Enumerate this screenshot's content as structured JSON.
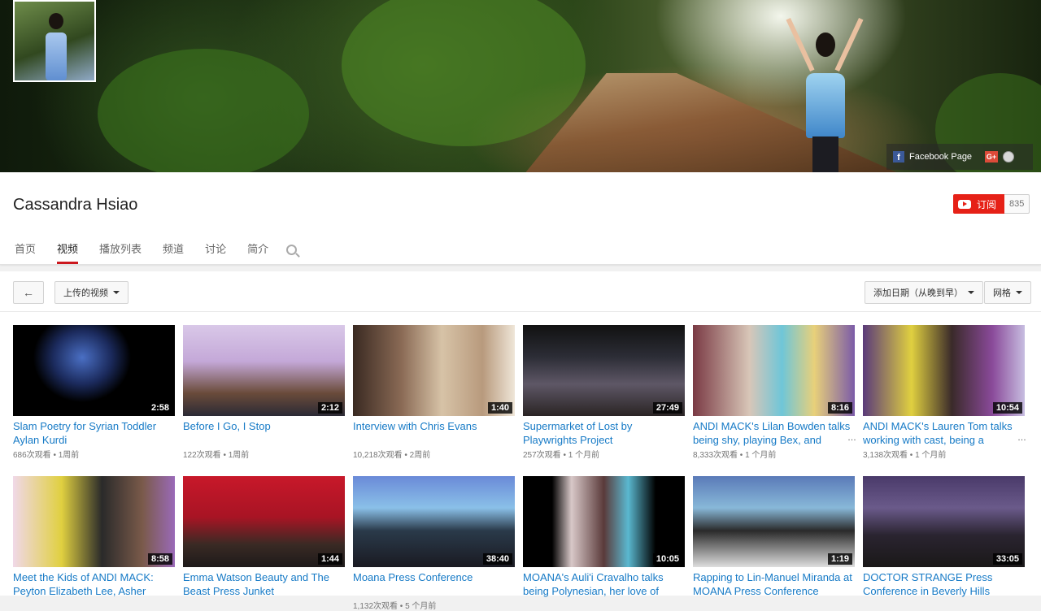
{
  "banner": {
    "social": {
      "facebook": "Facebook Page",
      "gplus": "G+"
    }
  },
  "channel": {
    "name": "Cassandra Hsiao"
  },
  "subscribe": {
    "label": "订阅",
    "count": "835"
  },
  "tabs": [
    {
      "label": "首页"
    },
    {
      "label": "视频"
    },
    {
      "label": "播放列表"
    },
    {
      "label": "频道"
    },
    {
      "label": "讨论"
    },
    {
      "label": "简介"
    }
  ],
  "toolbar": {
    "uploads": "上传的视频",
    "sort": "添加日期（从晚到早）",
    "view": "网格"
  },
  "colors": {
    "accent": "#cc181e",
    "link": "#167ac6",
    "subscribe": "#e62117"
  },
  "videos": [
    {
      "title": "Slam Poetry for Syrian Toddler Aylan Kurdi",
      "duration": "2:58",
      "views": "686次观看",
      "age": "1周前"
    },
    {
      "title": "Before I Go, I Stop",
      "duration": "2:12",
      "views": "122次观看",
      "age": "1周前"
    },
    {
      "title": "Interview with Chris Evans",
      "duration": "1:40",
      "views": "10,218次观看",
      "age": "2周前"
    },
    {
      "title": "Supermarket of Lost by Playwrights Project",
      "duration": "27:49",
      "views": "257次观看",
      "age": "1 个月前"
    },
    {
      "title": "ANDI MACK's Lilan Bowden talks being shy, playing Bex, and",
      "duration": "8:16",
      "views": "8,333次观看",
      "age": "1 个月前"
    },
    {
      "title": "ANDI MACK's Lauren Tom talks working with cast, being a",
      "duration": "10:54",
      "views": "3,138次观看",
      "age": "1 个月前"
    },
    {
      "title": "Meet the Kids of ANDI MACK: Peyton Elizabeth Lee, Asher",
      "duration": "8:58",
      "views": "",
      "age": ""
    },
    {
      "title": "Emma Watson Beauty and The Beast Press Junket",
      "duration": "1:44",
      "views": "",
      "age": ""
    },
    {
      "title": "Moana Press Conference",
      "duration": "38:40",
      "views": "1,132次观看",
      "age": "5 个月前"
    },
    {
      "title": "MOANA's Auli'i Cravalho talks being Polynesian, her love of",
      "duration": "10:05",
      "views": "",
      "age": ""
    },
    {
      "title": "Rapping to Lin-Manuel Miranda at MOANA Press Conference",
      "duration": "1:19",
      "views": "",
      "age": ""
    },
    {
      "title": "DOCTOR STRANGE Press Conference in Beverly Hills",
      "duration": "33:05",
      "views": "",
      "age": ""
    }
  ]
}
